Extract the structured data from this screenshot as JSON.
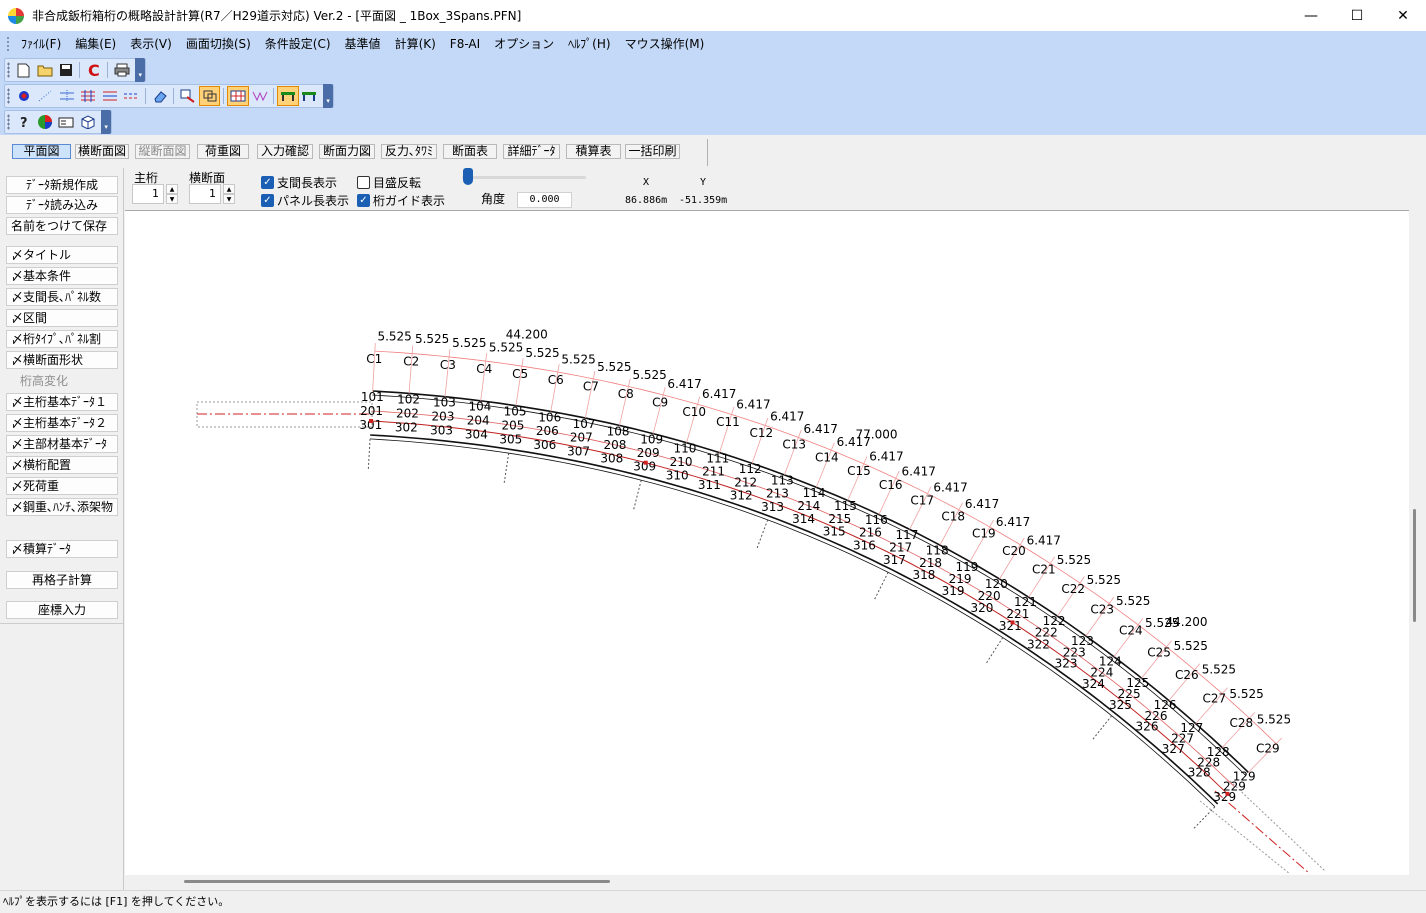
{
  "window": {
    "title": "非合成鈑桁箱桁の概略設計計算(R7／H29道示対応) Ver.2 - [平面図 _ 1Box_3Spans.PFN]",
    "minimize": "—",
    "maximize": "☐",
    "close": "✕"
  },
  "menu": [
    "ﾌｧｲﾙ(F)",
    "編集(E)",
    "表示(V)",
    "画面切換(S)",
    "条件設定(C)",
    "基準値",
    "計算(K)",
    "F8-AI",
    "オプション",
    "ﾍﾙﾌﾟ(H)",
    "マウス操作(M)"
  ],
  "toolbars": {
    "row1": [
      "new-file-icon",
      "open-folder-icon",
      "save-disk-icon",
      "calc-c-icon",
      "print-icon"
    ],
    "row2": [
      "node-dot-icon",
      "dotted-line-icon",
      "line-pattern-icon",
      "grid-lines-icon",
      "colored-lines-icon",
      "dash-lines-icon",
      "eraser-icon",
      "transfer-icon",
      "select-box-icon",
      "grid-select-icon",
      "wave-icon",
      "beam-yellow-icon",
      "beam-green-icon"
    ],
    "row3": [
      "help-icon",
      "color-wheel-icon",
      "card-icon",
      "box-3d-icon"
    ]
  },
  "view_tabs": [
    {
      "label": "平面図",
      "state": "active"
    },
    {
      "label": "横断面図",
      "state": "normal"
    },
    {
      "label": "縦断面図",
      "state": "disabled"
    },
    {
      "label": "荷重図",
      "state": "normal"
    },
    {
      "label": "入力確認",
      "state": "normal"
    },
    {
      "label": "断面力図",
      "state": "normal"
    },
    {
      "label": "反力､ﾀﾜﾐ",
      "state": "normal"
    },
    {
      "label": "断面表",
      "state": "normal"
    },
    {
      "label": "詳細ﾃﾞｰﾀ",
      "state": "normal"
    },
    {
      "label": "積算表",
      "state": "normal"
    },
    {
      "label": "一括印刷",
      "state": "normal"
    }
  ],
  "left_buttons": [
    {
      "label": "ﾃﾞｰﾀ新規作成",
      "style": "center"
    },
    {
      "label": "ﾃﾞｰﾀ読み込み",
      "style": "center"
    },
    {
      "label": "名前をつけて保存",
      "style": "normal"
    },
    {
      "label": "〆タイトル",
      "style": "normal"
    },
    {
      "label": "〆基本条件",
      "style": "normal"
    },
    {
      "label": "〆支間長､ﾊﾟﾈﾙ数",
      "style": "normal"
    },
    {
      "label": "〆区間",
      "style": "normal"
    },
    {
      "label": "〆桁ﾀｲﾌﾟ､ﾊﾟﾈﾙ割",
      "style": "normal"
    },
    {
      "label": "〆横断面形状",
      "style": "normal"
    },
    {
      "label": "桁高変化",
      "style": "disabled"
    },
    {
      "label": "〆主桁基本ﾃﾞｰﾀ１",
      "style": "normal"
    },
    {
      "label": "〆主桁基本ﾃﾞｰﾀ２",
      "style": "normal"
    },
    {
      "label": "〆主部材基本ﾃﾞｰﾀ",
      "style": "normal"
    },
    {
      "label": "〆横桁配置",
      "style": "normal"
    },
    {
      "label": "〆死荷重",
      "style": "normal"
    },
    {
      "label": "〆鋼重､ﾊﾝﾁ､添架物",
      "style": "normal"
    },
    {
      "label": "〆積算ﾃﾞｰﾀ",
      "style": "normal"
    },
    {
      "label": "再格子計算",
      "style": "center"
    },
    {
      "label": "座標入力",
      "style": "center"
    }
  ],
  "controls": {
    "main_girder_label": "主桁",
    "main_girder_value": "1",
    "cross_section_label": "横断面",
    "cross_section_value": "1",
    "chk_span_length": {
      "label": "支間長表示",
      "checked": true
    },
    "chk_panel_length": {
      "label": "パネル長表示",
      "checked": true
    },
    "chk_scale_flip": {
      "label": "目盛反転",
      "checked": false
    },
    "chk_girder_guide": {
      "label": "桁ガイド表示",
      "checked": true
    },
    "angle_label": "角度",
    "angle_value": "0.000",
    "x_label": "X",
    "y_label": "Y",
    "x_value": "86.886m",
    "y_value": "-51.359m"
  },
  "drawing": {
    "span_totals": [
      "44.200",
      "77.000",
      "44.200"
    ],
    "panel_lengths": [
      "5.525",
      "5.525",
      "5.525",
      "5.525",
      "5.525",
      "5.525",
      "5.525",
      "5.525",
      "6.417",
      "6.417",
      "6.417",
      "6.417",
      "6.417",
      "6.417",
      "6.417",
      "6.417",
      "6.417",
      "6.417",
      "6.417",
      "6.417",
      "5.525",
      "5.525",
      "5.525",
      "5.525",
      "5.525",
      "5.525",
      "5.525",
      "5.525"
    ],
    "cross_beams": [
      "C1",
      "C2",
      "C3",
      "C4",
      "C5",
      "C6",
      "C7",
      "C8",
      "C9",
      "C10",
      "C11",
      "C12",
      "C13",
      "C14",
      "C15",
      "C16",
      "C17",
      "C18",
      "C19",
      "C20",
      "C21",
      "C22",
      "C23",
      "C24",
      "C25",
      "C26",
      "C27",
      "C28",
      "C29"
    ],
    "row1_nodes": [
      "101",
      "102",
      "103",
      "104",
      "105",
      "106",
      "107",
      "108",
      "109",
      "110",
      "111",
      "112",
      "113",
      "114",
      "115",
      "116",
      "117",
      "118",
      "119",
      "120",
      "121",
      "122",
      "123",
      "124",
      "125",
      "126",
      "127",
      "128",
      "129"
    ],
    "row2_nodes": [
      "201",
      "202",
      "203",
      "204",
      "205",
      "206",
      "207",
      "208",
      "209",
      "210",
      "211",
      "212",
      "213",
      "214",
      "215",
      "216",
      "217",
      "218",
      "219",
      "220",
      "221",
      "222",
      "223",
      "224",
      "225",
      "226",
      "227",
      "228",
      "229"
    ],
    "row3_nodes": [
      "301",
      "302",
      "303",
      "304",
      "305",
      "306",
      "307",
      "308",
      "309",
      "310",
      "311",
      "312",
      "313",
      "314",
      "315",
      "316",
      "317",
      "318",
      "319",
      "320",
      "321",
      "322",
      "323",
      "324",
      "325",
      "326",
      "327",
      "328",
      "329"
    ]
  },
  "status": "ﾍﾙﾌﾟを表示するには [F1] を押してください。"
}
